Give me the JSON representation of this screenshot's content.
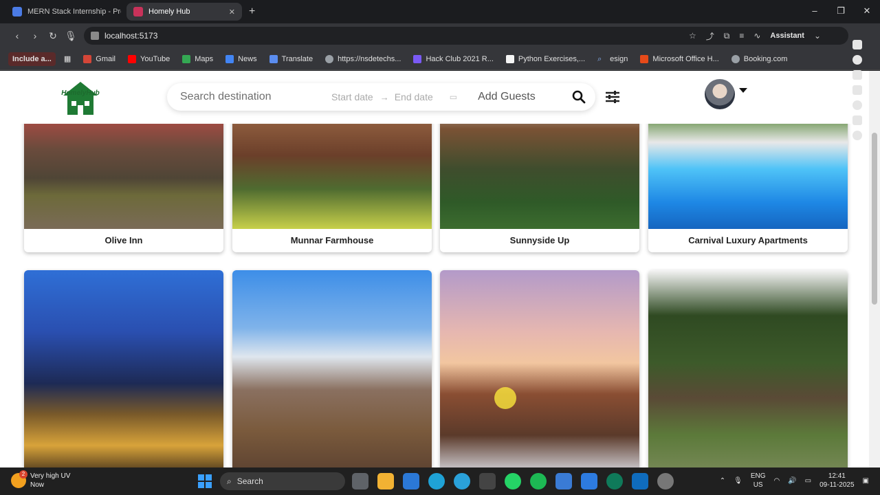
{
  "browser": {
    "tabs": [
      {
        "label": "MERN Stack Internship - Pres",
        "active": false
      },
      {
        "label": "Homely Hub",
        "active": true
      }
    ],
    "url": "localhost:5173",
    "assistant_label": "Assistant"
  },
  "bookmarks": [
    {
      "label": "Include a..."
    },
    {
      "label": "Gmail"
    },
    {
      "label": "YouTube"
    },
    {
      "label": "Maps"
    },
    {
      "label": "News"
    },
    {
      "label": "Translate"
    },
    {
      "label": "https://nsdetechs..."
    },
    {
      "label": "Hack Club 2021 R..."
    },
    {
      "label": "Python Exercises,..."
    },
    {
      "label": "esign"
    },
    {
      "label": "Microsoft Office H..."
    },
    {
      "label": "Booking.com"
    }
  ],
  "app": {
    "logo_text": "HomelyHub",
    "search": {
      "destination_placeholder": "Search destination",
      "start_date": "Start date",
      "end_date": "End date",
      "guests": "Add Guests"
    }
  },
  "listings": [
    {
      "name": "Olive Inn"
    },
    {
      "name": "Munnar Farmhouse"
    },
    {
      "name": "Sunnyside Up"
    },
    {
      "name": "Carnival Luxury Apartments"
    }
  ],
  "taskbar": {
    "weather_title": "Very high UV",
    "weather_sub": "Now",
    "weather_badge": "2",
    "search_label": "Search",
    "lang_top": "ENG",
    "lang_bottom": "US",
    "time": "12:41",
    "date": "09-11-2025"
  }
}
